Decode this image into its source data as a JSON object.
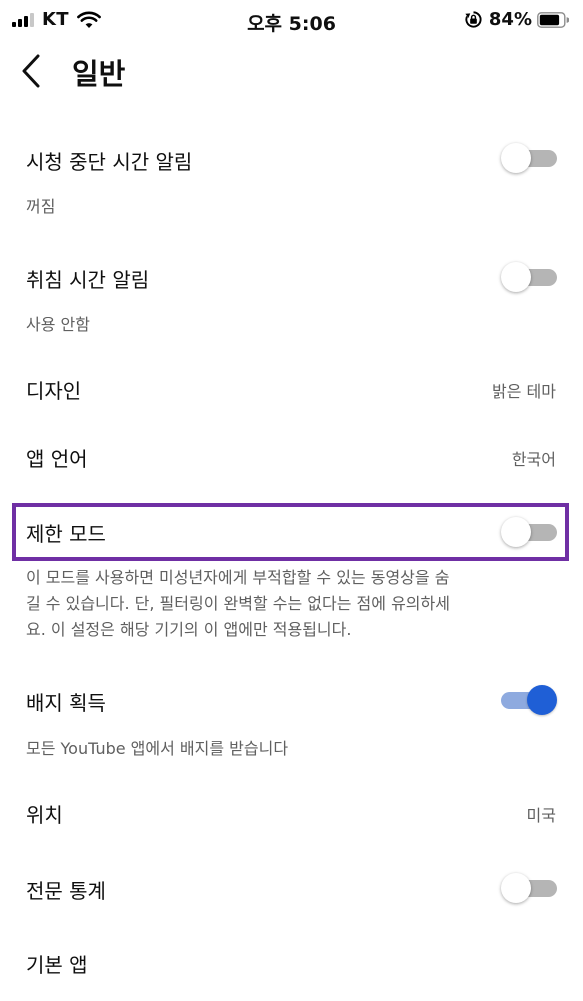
{
  "status_bar": {
    "carrier": "KT",
    "time": "오후 5:06",
    "battery_percent": "84%",
    "battery_level": 0.84
  },
  "header": {
    "title": "일반"
  },
  "settings": {
    "watch_break": {
      "title": "시청 중단 시간 알림",
      "subtitle": "꺼짐",
      "enabled": false
    },
    "bedtime": {
      "title": "취침 시간 알림",
      "subtitle": "사용 안함",
      "enabled": false
    },
    "design": {
      "title": "디자인",
      "value": "밝은 테마"
    },
    "app_language": {
      "title": "앱 언어",
      "value": "한국어"
    },
    "restricted_mode": {
      "title": "제한 모드",
      "enabled": false,
      "description_lines": [
        "이 모드를 사용하면 미성년자에게 부적합할 수 있는 동영상을 숨",
        "길 수 있습니다. 단, 필터링이 완벽할 수는 없다는 점에 유의하세",
        "요. 이 설정은 해당 기기의 이 앱에만 적용됩니다."
      ]
    },
    "badges": {
      "title": "배지 획득",
      "subtitle": "모든 YouTube 앱에서 배지를 받습니다",
      "enabled": true
    },
    "location": {
      "title": "위치",
      "value": "미국"
    },
    "stats_for_nerds": {
      "title": "전문 통계",
      "enabled": false
    },
    "default_app": {
      "title": "기본 앱"
    }
  },
  "colors": {
    "highlight_border": "#6f2fa4",
    "toggle_on": "#1f5fd6",
    "toggle_off_track": "#b5b5b5"
  }
}
